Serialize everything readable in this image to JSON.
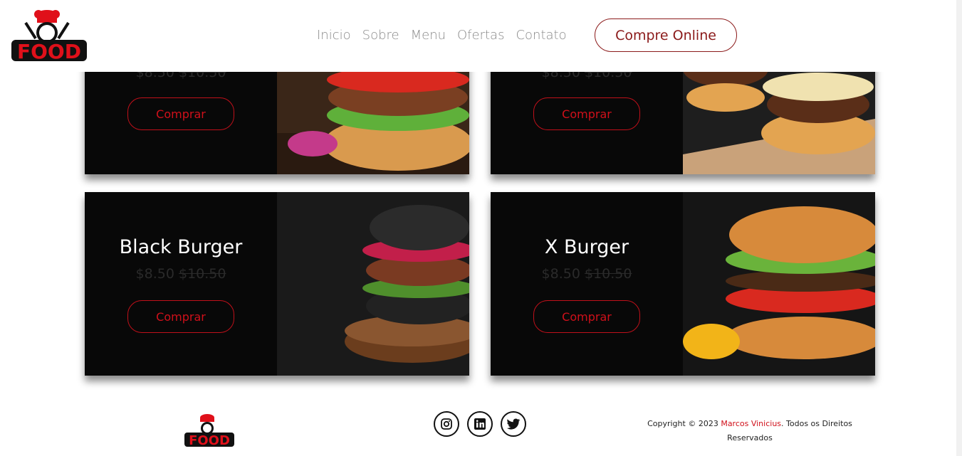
{
  "brand": {
    "logo_text": "FOOD"
  },
  "nav": {
    "items": [
      "Inicio",
      "Sobre",
      "Menu",
      "Ofertas",
      "Contato"
    ],
    "cta_label": "Compre Online"
  },
  "cards": [
    {
      "title": "",
      "price_new": "$8.50",
      "price_old": "$10.50",
      "button": "Comprar"
    },
    {
      "title": "",
      "price_new": "$8.50",
      "price_old": "$10.50",
      "button": "Comprar"
    },
    {
      "title": "Black Burger",
      "price_new": "$8.50",
      "price_old": "$10.50",
      "button": "Comprar"
    },
    {
      "title": "X Burger",
      "price_new": "$8.50",
      "price_old": "$10.50",
      "button": "Comprar"
    }
  ],
  "footer": {
    "logo_text": "FOOD",
    "social": [
      "instagram-icon",
      "linkedin-icon",
      "twitter-icon"
    ],
    "copyright_prefix": "Copyright © 2023",
    "author": "Marcos Vinicius",
    "copyright_suffix": ". Todos os Direitos Reservados"
  },
  "colors": {
    "accent": "#d0101a",
    "nav_text": "#8a8a8a",
    "cta": "#8b1a1a",
    "card_bg": "#0b0b0b"
  }
}
